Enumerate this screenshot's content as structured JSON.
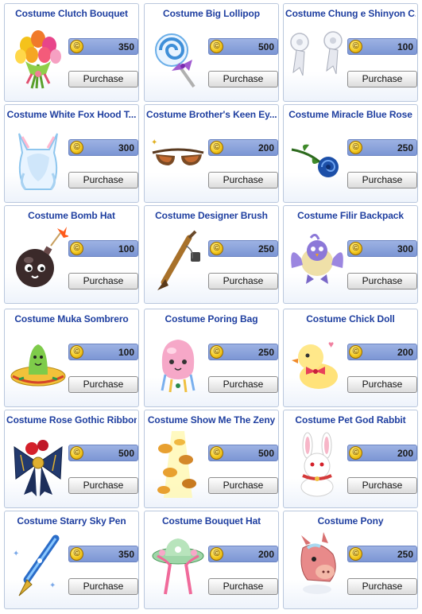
{
  "coin_glyph": "©",
  "purchase_label": "Purchase",
  "items": [
    {
      "name": "Costume Clutch Bouquet",
      "price": "350",
      "icon": "flower-bouquet-icon"
    },
    {
      "name": "Costume Big Lollipop",
      "price": "500",
      "icon": "lollipop-icon"
    },
    {
      "name": "Costume Chung e Shinyon C...",
      "price": "100",
      "icon": "white-hair-ornaments-icon"
    },
    {
      "name": "Costume White Fox Hood T...",
      "price": "300",
      "icon": "white-fox-hood-icon"
    },
    {
      "name": "Costume Brother's Keen Ey...",
      "price": "200",
      "icon": "sunglasses-icon"
    },
    {
      "name": "Costume Miracle Blue Rose",
      "price": "250",
      "icon": "blue-rose-icon"
    },
    {
      "name": "Costume Bomb Hat",
      "price": "100",
      "icon": "bomb-hat-icon"
    },
    {
      "name": "Costume Designer Brush",
      "price": "250",
      "icon": "designer-brush-icon"
    },
    {
      "name": "Costume Filir Backpack",
      "price": "300",
      "icon": "filir-backpack-icon"
    },
    {
      "name": "Costume Muka Sombrero",
      "price": "100",
      "icon": "sombrero-icon"
    },
    {
      "name": "Costume Poring Bag",
      "price": "250",
      "icon": "poring-bag-icon"
    },
    {
      "name": "Costume Chick Doll",
      "price": "200",
      "icon": "chick-doll-icon"
    },
    {
      "name": "Costume Rose Gothic Ribbon",
      "price": "500",
      "icon": "gothic-ribbon-icon"
    },
    {
      "name": "Costume Show Me The Zeny",
      "price": "500",
      "icon": "zeny-coins-icon"
    },
    {
      "name": "Costume Pet God Rabbit",
      "price": "200",
      "icon": "rabbit-icon"
    },
    {
      "name": "Costume Starry Sky Pen",
      "price": "350",
      "icon": "fountain-pen-icon"
    },
    {
      "name": "Costume Bouquet Hat",
      "price": "200",
      "icon": "bouquet-hat-icon"
    },
    {
      "name": "Costume Pony",
      "price": "250",
      "icon": "pony-icon"
    }
  ]
}
